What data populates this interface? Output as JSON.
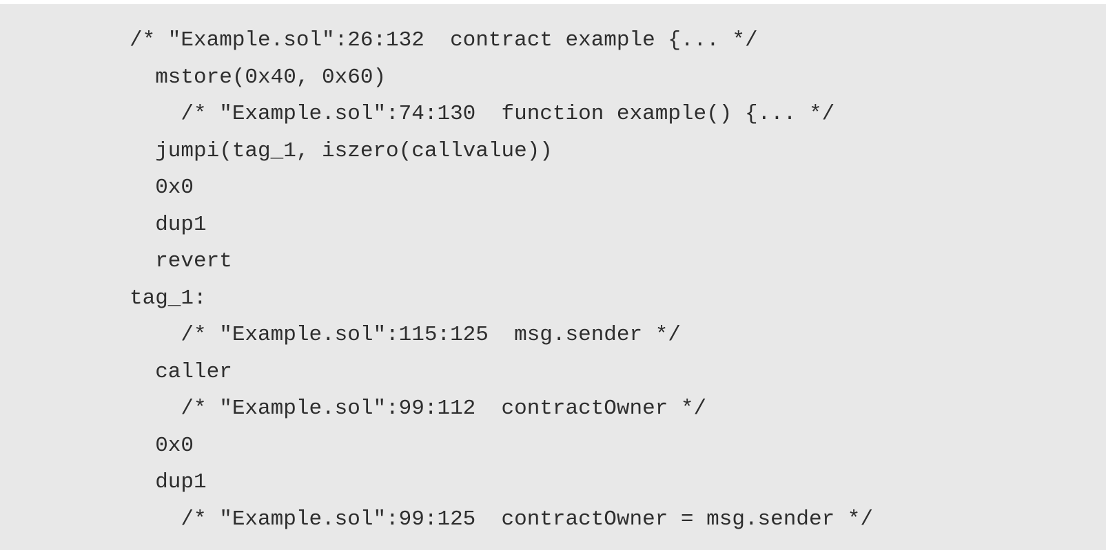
{
  "code": {
    "lines": [
      "/* \"Example.sol\":26:132  contract example {... */",
      "  mstore(0x40, 0x60)",
      "    /* \"Example.sol\":74:130  function example() {... */",
      "  jumpi(tag_1, iszero(callvalue))",
      "  0x0",
      "  dup1",
      "  revert",
      "tag_1:",
      "    /* \"Example.sol\":115:125  msg.sender */",
      "  caller",
      "    /* \"Example.sol\":99:112  contractOwner */",
      "  0x0",
      "  dup1",
      "    /* \"Example.sol\":99:125  contractOwner = msg.sender */"
    ]
  }
}
